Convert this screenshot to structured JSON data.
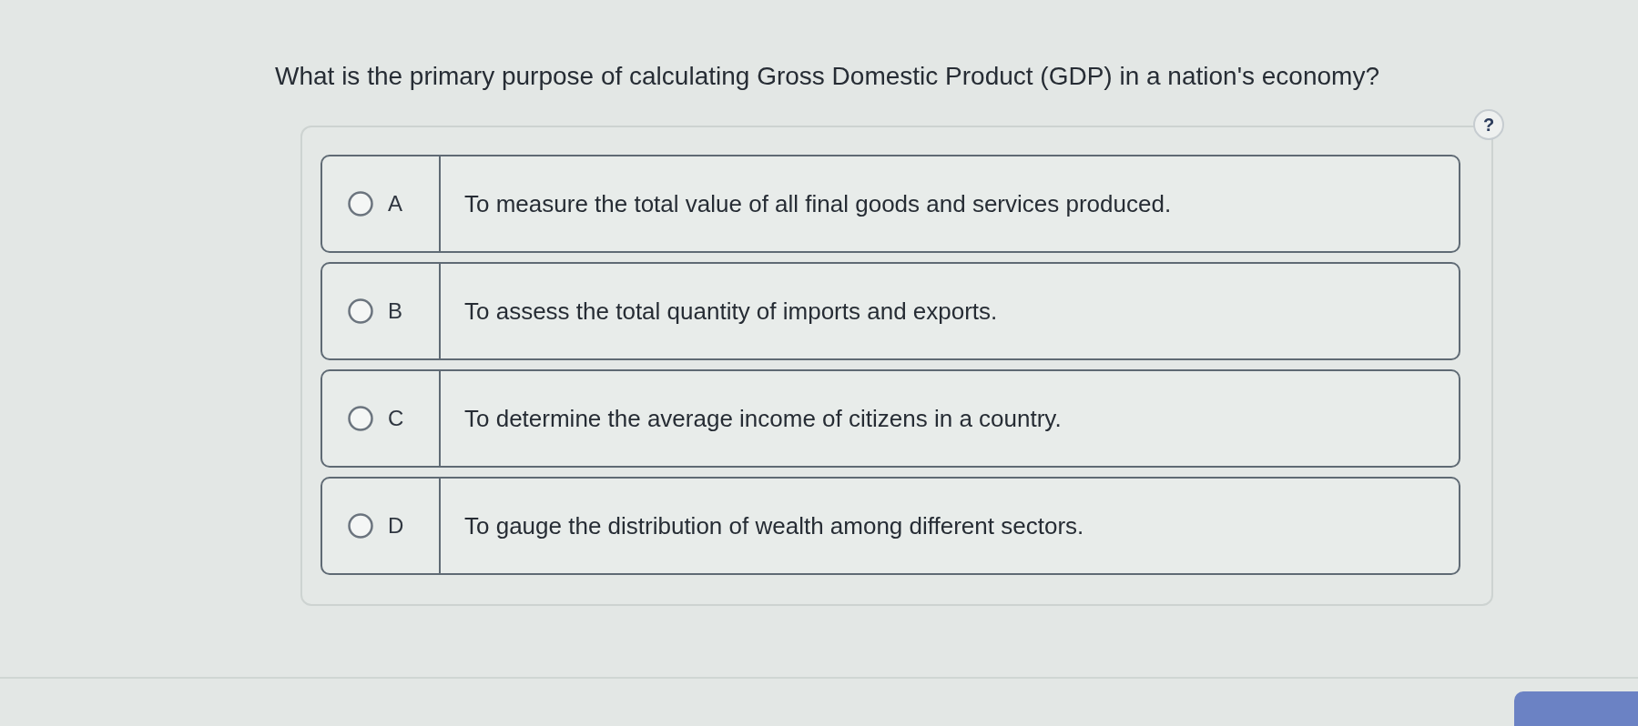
{
  "question": {
    "text": "What is the primary purpose of calculating Gross Domestic Product (GDP) in a nation's economy?"
  },
  "help": {
    "label": "?"
  },
  "options": [
    {
      "letter": "A",
      "text": "To measure the total value of all final goods and services produced.",
      "selected": false
    },
    {
      "letter": "B",
      "text": "To assess the total quantity of imports and exports.",
      "selected": false
    },
    {
      "letter": "C",
      "text": "To determine the average income of citizens in a country.",
      "selected": false
    },
    {
      "letter": "D",
      "text": "To gauge the distribution of wealth among different sectors.",
      "selected": false
    }
  ]
}
